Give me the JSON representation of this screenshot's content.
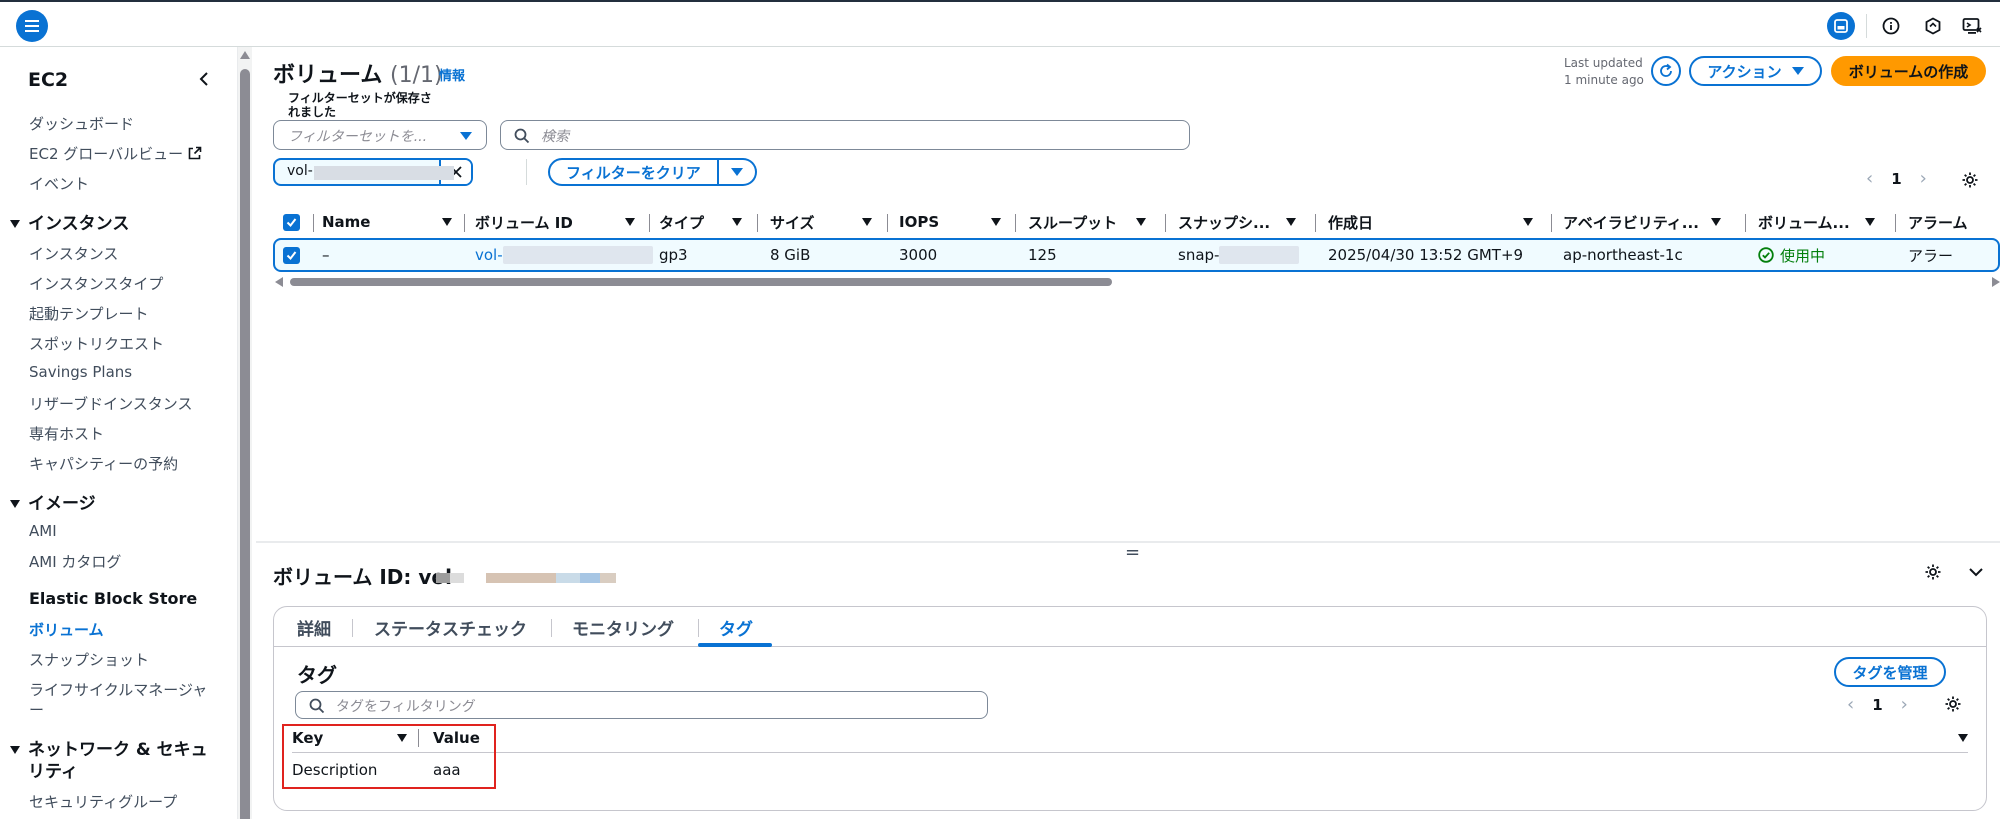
{
  "colors": {
    "accent": "#0972d3",
    "primary_button": "#ff9900",
    "success": "#037f0c",
    "highlight": "#e0231e"
  },
  "topbar": {
    "icons": [
      "menu-icon",
      "panel-icon",
      "info-icon",
      "notifications-icon",
      "cloudshell-icon"
    ]
  },
  "sidebar": {
    "title": "EC2",
    "items_top": [
      "ダッシュボード",
      "EC2 グローバルビュー",
      "イベント"
    ],
    "sections": [
      {
        "label": "インスタンス",
        "items": [
          "インスタンス",
          "インスタンスタイプ",
          "起動テンプレート",
          "スポットリクエスト",
          "Savings Plans",
          "リザーブドインスタンス",
          "専有ホスト",
          "キャパシティーの予約"
        ]
      },
      {
        "label": "イメージ",
        "items": [
          "AMI",
          "AMI カタログ"
        ]
      }
    ],
    "ebs": {
      "label": "Elastic Block Store",
      "items": [
        "ボリューム",
        "スナップショット",
        "ライフサイクルマネージャ",
        "ー"
      ]
    },
    "network": {
      "label_line1": "ネットワーク & セキュ",
      "label_line2": "リティ",
      "items": [
        "セキュリティグループ"
      ]
    }
  },
  "main": {
    "title": "ボリューム",
    "count": "(1/1)",
    "info": "情報",
    "last_updated_line1": "Last updated",
    "last_updated_line2": "1 minute ago",
    "actions_label": "アクション",
    "create_label": "ボリュームの作成",
    "filterset_label": "フィルターセットが保存されました",
    "filterset_placeholder": "フィルターセットを...",
    "search_placeholder": "検索",
    "token_text": "vol-",
    "clear_filters": "フィルターをクリア",
    "page": "1",
    "columns": [
      "Name",
      "ボリューム ID",
      "タイプ",
      "サイズ",
      "IOPS",
      "スループット",
      "スナップシ...",
      "作成日",
      "アベイラビリティ...",
      "ボリューム...",
      "アラーム"
    ],
    "row": {
      "name": "–",
      "volume_id": "vol-",
      "type": "gp3",
      "size": "8 GiB",
      "iops": "3000",
      "throughput": "125",
      "snapshot": "snap-",
      "created": "2025/04/30 13:52 GMT+9",
      "az": "ap-northeast-1c",
      "status": "使用中",
      "alarm": "アラー"
    }
  },
  "details": {
    "title": "ボリューム ID: vol-",
    "tabs": [
      "詳細",
      "ステータスチェック",
      "モニタリング",
      "タグ"
    ],
    "active_tab": "タグ",
    "tags_title": "タグ",
    "manage_tags": "タグを管理",
    "tag_filter_placeholder": "タグをフィルタリング",
    "page": "1",
    "tag_columns": [
      "Key",
      "Value"
    ],
    "tags": [
      {
        "key": "Description",
        "value": "aaa"
      }
    ]
  }
}
